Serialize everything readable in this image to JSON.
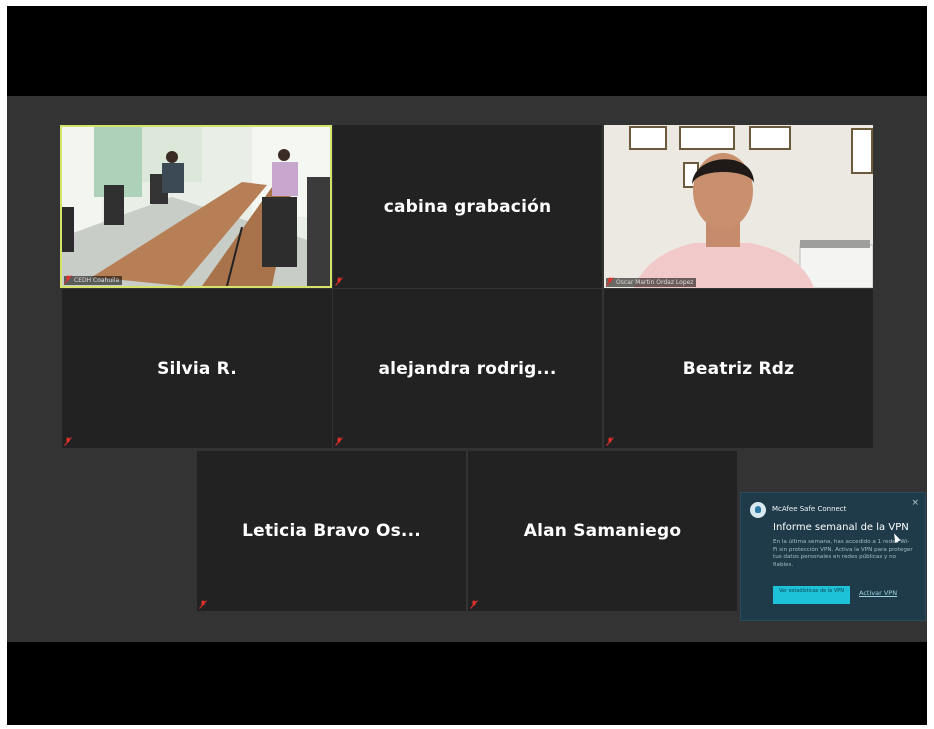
{
  "meeting": {
    "participants": [
      {
        "id": "video1",
        "name": "",
        "video_label": "CEDH Coahuila",
        "video": true,
        "active": true
      },
      {
        "id": "p2",
        "name": "cabina grabación"
      },
      {
        "id": "video2",
        "name": "",
        "video_label": "Oscar Martin Ordaz Lopez",
        "video": true
      },
      {
        "id": "p4",
        "name": "Silvia R."
      },
      {
        "id": "p5",
        "name": "alejandra  rodrig..."
      },
      {
        "id": "p6",
        "name": "Beatriz Rdz"
      },
      {
        "id": "p7",
        "name": "Leticia  Bravo  Os..."
      },
      {
        "id": "p8",
        "name": "Alan Samaniego"
      }
    ]
  },
  "toast": {
    "brand": "McAfee Safe Connect",
    "close": "×",
    "title": "Informe semanal de la VPN",
    "body": "En la última semana, has accedido a 1 redes Wi-Fi sin protección VPN. Activa la VPN para proteger tus datos personales en redes públicas y no fiables.",
    "primary_label": "Ver estadísticas de la VPN",
    "secondary_label": "Activar VPN"
  },
  "colors": {
    "stage_bg": "#333333",
    "tile_bg": "#222222",
    "active_speaker": "#d6e36a",
    "mic_muted": "#e0312b",
    "toast_bg": "#1f3b49",
    "toast_button": "#1ec2d8"
  }
}
